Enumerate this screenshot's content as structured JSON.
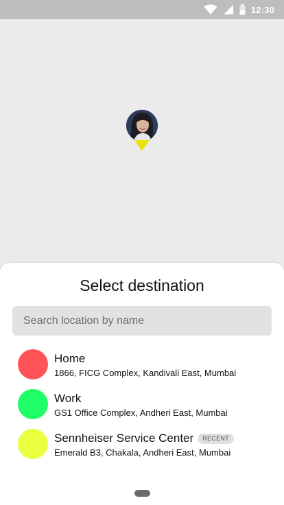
{
  "status_bar": {
    "time": "12:30",
    "icons": [
      "wifi-icon",
      "cell-signal-icon",
      "battery-icon"
    ]
  },
  "map": {
    "pin_icon": "user-avatar-pin",
    "pin_color": "#e9e500"
  },
  "sheet": {
    "title": "Select destination",
    "search": {
      "placeholder": "Search location by name",
      "value": ""
    },
    "destinations": [
      {
        "name": "Home",
        "address": "1866, FICG Complex, Kandivali East, Mumbai",
        "color": "#ff5457",
        "badge": ""
      },
      {
        "name": "Work",
        "address": "GS1 Office Complex, Andheri East, Mumbai",
        "color": "#20ff68",
        "badge": ""
      },
      {
        "name": "Sennheiser Service Center",
        "address": "Emerald B3, Chakala, Andheri East, Mumbai",
        "color": "#eaff3d",
        "badge": "RECENT"
      }
    ]
  },
  "home_indicator": "home-handle"
}
